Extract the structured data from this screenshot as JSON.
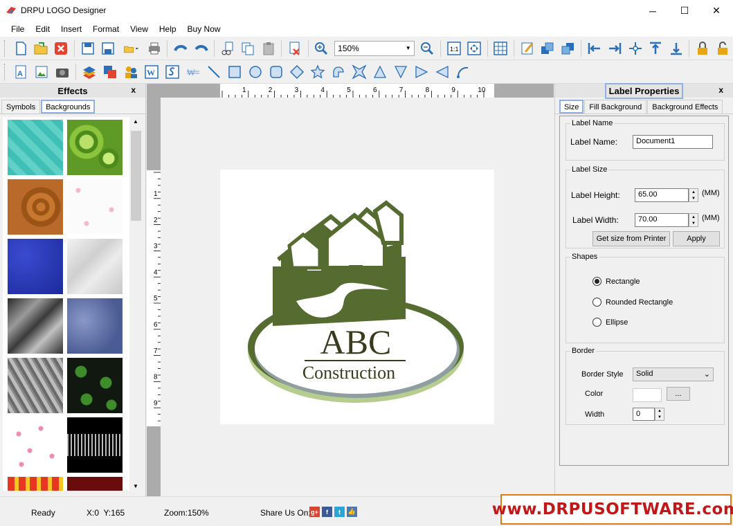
{
  "window": {
    "title": "DRPU LOGO Designer",
    "min": "─",
    "max": "☐",
    "close": "✕"
  },
  "menu": [
    "File",
    "Edit",
    "Insert",
    "Format",
    "View",
    "Help",
    "Buy Now"
  ],
  "toolbar": {
    "zoom_value": "150%"
  },
  "effects": {
    "title": "Effects",
    "close": "x",
    "tabs": [
      "Symbols",
      "Backgrounds"
    ],
    "active_tab": "Backgrounds"
  },
  "ruler": {
    "h_labels": [
      "1",
      "2",
      "3",
      "4",
      "5",
      "6",
      "7",
      "8",
      "9",
      "10"
    ],
    "v_labels": [
      "1",
      "2",
      "3",
      "4",
      "5",
      "6",
      "7",
      "8",
      "9"
    ]
  },
  "logo": {
    "line1": "ABC",
    "line2": "Construction",
    "color": "#556b2f",
    "ring_color": "#b6cd8e"
  },
  "props": {
    "title": "Label Properties",
    "close": "x",
    "tabs": [
      "Size",
      "Fill Background",
      "Background Effects"
    ],
    "active_tab": "Size",
    "label_name_group": "Label Name",
    "label_name_label": "Label Name:",
    "label_name_value": "Document1",
    "size_group": "Label Size",
    "height_label": "Label Height:",
    "height_value": "65.00",
    "width_label": "Label Width:",
    "width_value": "70.00",
    "unit": "(MM)",
    "printer_button": "Get size from Printer",
    "apply_button": "Apply",
    "shapes_group": "Shapes",
    "shapes": [
      "Rectangle",
      "Rounded Rectangle",
      "Ellipse"
    ],
    "selected_shape": "Rectangle",
    "border_group": "Border",
    "border_style_label": "Border Style",
    "border_style_value": "Solid",
    "color_label": "Color",
    "color_button": "...",
    "width_label2": "Width",
    "border_width_value": "0"
  },
  "status": {
    "ready": "Ready",
    "coords": "X:0  Y:165",
    "zoom": "Zoom:150%",
    "share": "Share Us On:",
    "brand": "www.DRPUSOFTWARE.com"
  },
  "colors": {
    "accent": "#8fb0e0",
    "brand_red": "#c01818",
    "brand_border": "#e07a10"
  }
}
